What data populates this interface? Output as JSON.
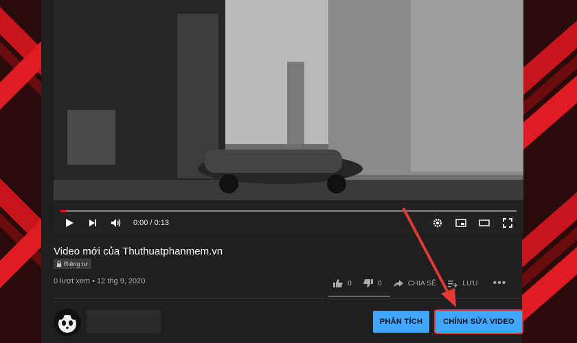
{
  "video": {
    "time": "0:00 / 0:13",
    "progress_fraction": 0.01,
    "accent": "#ff0000"
  },
  "details": {
    "title": "Video mới của Thuthuatphanmem.vn",
    "privacy": "Riêng tư",
    "meta": "0 lượt xem • 12 thg 9, 2020"
  },
  "actions": {
    "likes": "0",
    "dislikes": "0",
    "share": "CHIA SẺ",
    "save": "LƯU"
  },
  "buttons": {
    "analytics": "PHÂN TÍCH",
    "edit": "CHỈNH SỬA VIDEO"
  },
  "colors": {
    "button_blue": "#3ea6ff",
    "highlight_red": "#e53935"
  }
}
